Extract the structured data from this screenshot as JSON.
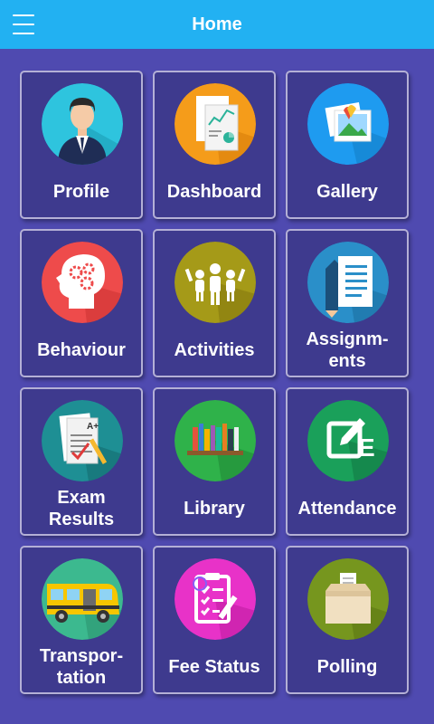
{
  "header": {
    "title": "Home"
  },
  "colors": {
    "appbar": "#22b1f2",
    "background": "#4f4ab0",
    "tile": "#3e3a8e",
    "tile_border": "#b4b0d6"
  },
  "tiles": [
    {
      "label": "Profile",
      "icon": "profile-icon"
    },
    {
      "label": "Dashboard",
      "icon": "dashboard-icon"
    },
    {
      "label": "Gallery",
      "icon": "gallery-icon"
    },
    {
      "label": "Behaviour",
      "icon": "brain-gears-icon"
    },
    {
      "label": "Activities",
      "icon": "activities-icon"
    },
    {
      "label": "Assignm-\nents",
      "icon": "assignments-icon"
    },
    {
      "label": "Exam\nResults",
      "icon": "exam-results-icon"
    },
    {
      "label": "Library",
      "icon": "library-icon"
    },
    {
      "label": "Attendance",
      "icon": "attendance-icon"
    },
    {
      "label": "Transpor-\ntation",
      "icon": "bus-icon"
    },
    {
      "label": "Fee Status",
      "icon": "fee-status-icon"
    },
    {
      "label": "Polling",
      "icon": "ballot-box-icon"
    }
  ]
}
